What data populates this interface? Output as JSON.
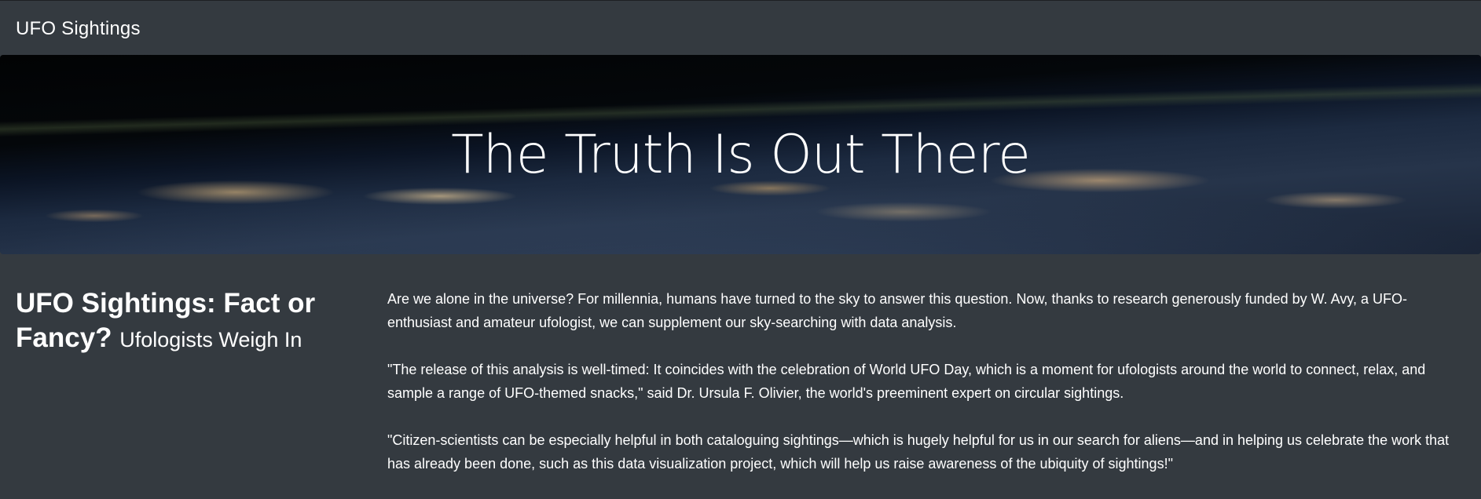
{
  "navbar": {
    "brand": "UFO Sightings"
  },
  "hero": {
    "title": "The Truth Is Out There"
  },
  "article": {
    "heading": "UFO Sightings: Fact or Fancy?",
    "subheading": "Ufologists Weigh In",
    "paragraphs": [
      "Are we alone in the universe? For millennia, humans have turned to the sky to answer this question. Now, thanks to research generously funded by W. Avy, a UFO-enthusiast and amateur ufologist, we can supplement our sky-searching with data analysis.",
      "\"The release of this analysis is well-timed: It coincides with the celebration of World UFO Day, which is a moment for ufologists around the world to connect, relax, and sample a range of UFO-themed snacks,\" said Dr. Ursula F. Olivier, the world's preeminent expert on circular sightings.",
      "\"Citizen-scientists can be especially helpful in both cataloguing sightings—which is hugely helpful for us in our search for aliens—and in helping us celebrate the work that has already been done, such as this data visualization project, which will help us raise awareness of the ubiquity of sightings!\""
    ]
  },
  "colors": {
    "background": "#343a40",
    "text": "#ffffff"
  }
}
